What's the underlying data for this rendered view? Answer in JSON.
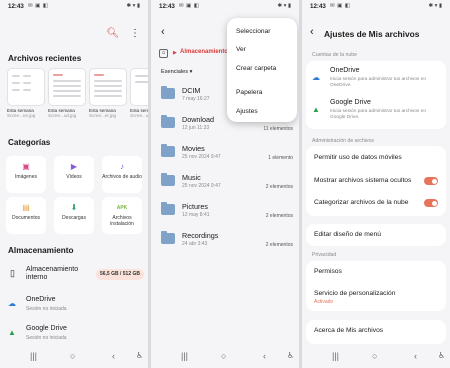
{
  "status": {
    "time": "12:43"
  },
  "p1": {
    "recent_title": "Archivos recientes",
    "recent": [
      {
        "t1": "Esta semana",
        "t2": "Scree...ne.jpg"
      },
      {
        "t1": "Esta semana",
        "t2": "Scree...ud.jpg"
      },
      {
        "t1": "Esta semana",
        "t2": "Scree...er.jpg"
      },
      {
        "t1": "Esta semana",
        "t2": "Scree...ul.jpg"
      }
    ],
    "categories_title": "Categorías",
    "categories": [
      "Imágenes",
      "Vídeos",
      "Archivos de audio",
      "Documentos",
      "Descargas",
      "Archivos instalación"
    ],
    "apk": "APK",
    "storage_title": "Almacenamiento",
    "internal": "Almacenamiento interno",
    "internal_usage": "56,5 GB / 512 GB",
    "onedrive": "OneDrive",
    "onedrive_sub": "Sesión no iniciada",
    "gdrive": "Google Drive",
    "gdrive_sub": "Sesión no iniciada"
  },
  "p2": {
    "breadcrumb": "Almacenamiento ir",
    "sort": "Esenciales",
    "folders": [
      {
        "name": "DCIM",
        "date": "7 may 16:27",
        "count": ""
      },
      {
        "name": "Download",
        "date": "12 jun 11:33",
        "count": "11 elementos"
      },
      {
        "name": "Movies",
        "date": "25 nov 2024 9:47",
        "count": "1 elemento"
      },
      {
        "name": "Music",
        "date": "25 nov 2024 9:47",
        "count": "2 elementos"
      },
      {
        "name": "Pictures",
        "date": "12 may 8:41",
        "count": "2 elementos"
      },
      {
        "name": "Recordings",
        "date": "24 abr 3:43",
        "count": "2 elementos"
      }
    ],
    "menu": [
      "Seleccionar",
      "Ver",
      "Crear carpeta",
      "Papelera",
      "Ajustes"
    ]
  },
  "p3": {
    "title": "Ajustes de Mis archivos",
    "cloud_hdr": "Cuentas de la nube",
    "onedrive": "OneDrive",
    "onedrive_desc": "Inicia sesión para administrar tus archivos en OneDrive.",
    "gdrive": "Google Drive",
    "gdrive_desc": "Inicia sesión para administrar tus archivos en Google Drive.",
    "admin_hdr": "Administración de archivos",
    "mobile_data": "Permitir uso de datos móviles",
    "hidden": "Mostrar archivos sistema ocultos",
    "categorize": "Categorizar archivos de la nube",
    "edit_menu": "Editar diseño de menú",
    "privacy_hdr": "Privacidad",
    "permisos": "Permisos",
    "custom": "Servicio de personalización",
    "custom_status": "Activado",
    "about": "Acerca de Mis archivos"
  },
  "colors": {
    "accent": "#e8745a",
    "folder": "#7fa3c8",
    "red": "#d93a3a"
  }
}
